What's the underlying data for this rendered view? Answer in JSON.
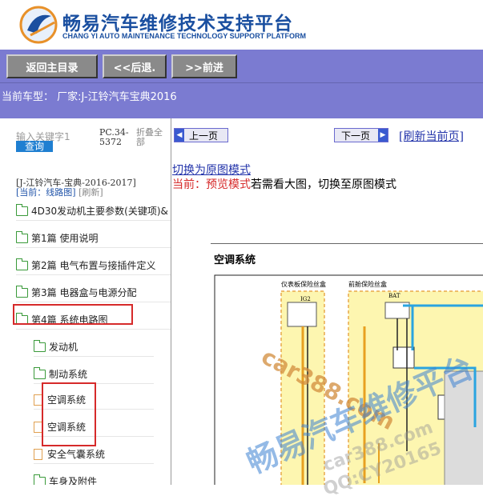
{
  "header": {
    "brand_cn": "畅易汽车维修技术支持平台",
    "brand_en": "CHANG YI AUTO MAINTENANCE TECHNOLOGY SUPPORT PLATFORM"
  },
  "nav": {
    "home": "返回主目录",
    "back": "<<后退.",
    "forward": ">>前进"
  },
  "car_info": "当前车型： 厂家:J-江铃汽车宝典2016",
  "left": {
    "search_placeholder": "输入关键字1",
    "search_btn": "查询",
    "pc_code": "PC.34-5372",
    "fold_all": "折叠全部",
    "book_title": "[J-江铃汽车-宝典-2016-2017]",
    "current": "[当前：线路图]",
    "refresh": "[刷新]",
    "tree": [
      {
        "label": "4D30发动机主要参数(关键项)&",
        "icon": "folder"
      },
      {
        "label": "第1篇 使用说明",
        "icon": "folder"
      },
      {
        "label": "第2篇 电气布置与接插件定义",
        "icon": "folder"
      },
      {
        "label": "第3篇 电器盒与电源分配",
        "icon": "folder"
      },
      {
        "label": "第4篇 系统电路图",
        "icon": "folder-open"
      },
      {
        "label": "发动机",
        "icon": "folder"
      },
      {
        "label": "制动系统",
        "icon": "folder"
      },
      {
        "label": "空调系统",
        "icon": "file"
      },
      {
        "label": "空调系统",
        "icon": "file"
      },
      {
        "label": "安全气囊系统",
        "icon": "file"
      },
      {
        "label": "车身及附件",
        "icon": "folder"
      }
    ]
  },
  "right": {
    "prev": "上一页",
    "next": "下一页",
    "refresh": "[刷新当前页]",
    "switch_link": "切换为原图模式",
    "mode_current": "当前：预览模式",
    "mode_tip": "若需看大图，切换至原图模式",
    "diagram": {
      "title": "空调系统",
      "box1": "仪表板保险丝盒",
      "box2": "前舱保险丝盒",
      "ig2": "IG2",
      "bat": "BAT"
    }
  },
  "watermarks": {
    "a": "car388.com",
    "b": "畅易汽车维修平台",
    "c": "car388.com",
    "d": "QQ:CY20165"
  },
  "colors": {
    "brand": "#1a4fa0",
    "nav_bg": "#7b7bd1",
    "highlight": "#d62a2a",
    "link": "#2233aa"
  }
}
